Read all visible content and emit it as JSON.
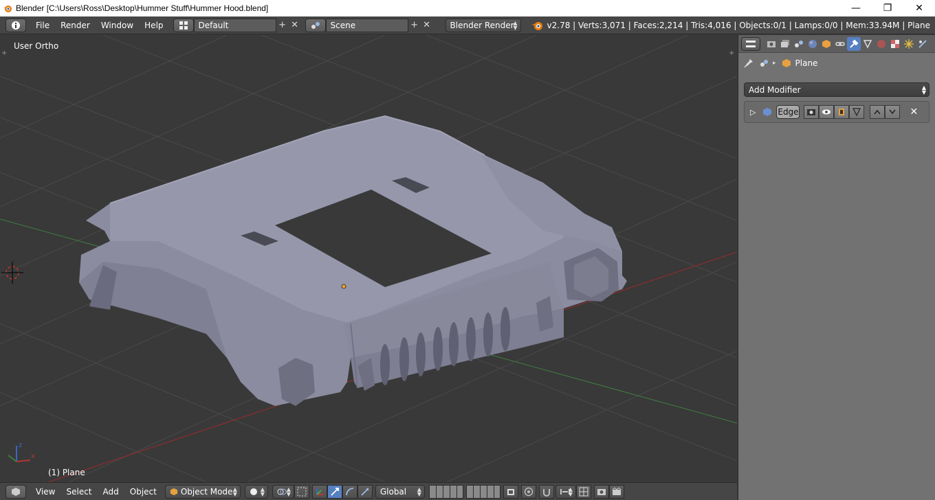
{
  "window": {
    "title": "Blender [C:\\Users\\Ross\\Desktop\\Hummer Stuff\\Hummer Hood.blend]",
    "controls": [
      "—",
      "❐",
      "✕"
    ]
  },
  "info_header": {
    "menus": [
      "File",
      "Render",
      "Window",
      "Help"
    ],
    "screen_layout": "Default",
    "scene": "Scene",
    "render_engine": "Blender Render",
    "stats": "v2.78 | Verts:3,071 | Faces:2,214 | Tris:4,016 | Objects:0/1 | Lamps:0/0 | Mem:33.94M | Plane"
  },
  "viewport": {
    "view_label": "User Ortho",
    "object_label": "(1) Plane",
    "axis_labels": {
      "x": "x",
      "z": "z"
    }
  },
  "properties": {
    "breadcrumb_object": "Plane",
    "add_modifier": "Add Modifier",
    "modifier_name": "Edge"
  },
  "bottom_header": {
    "menus": [
      "View",
      "Select",
      "Add",
      "Object"
    ],
    "mode": "Object Mode",
    "orientation": "Global"
  },
  "colors": {
    "active_tab": "#5680c2",
    "x_axis": "#9b2b2b",
    "y_axis": "#3f7f3f",
    "model": "#8b8ca0"
  }
}
